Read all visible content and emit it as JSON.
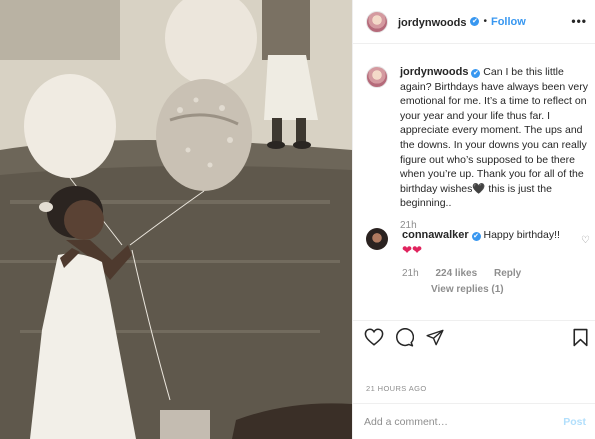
{
  "post": {
    "username": "jordynwoods",
    "verified_mark": "✔",
    "separator": "•",
    "follow_label": "Follow",
    "more_icon": "•••"
  },
  "caption": {
    "username": "jordynwoods",
    "text": "Can I be this little again? Birthdays have always been very emotional for me. It’s a time to reflect on your year and your life thus far. I appreciate every moment. The ups and the downs. In your downs you can really figure out who’s supposed to be there when you’re up. Thank you for all of the birthday wishes🖤 this is just the beginning..",
    "time": "21h"
  },
  "reply": {
    "username": "connawalker",
    "text": "Happy birthday!!",
    "hearts": "❤❤",
    "time": "21h",
    "likes": "224 likes",
    "reply_label": "Reply",
    "view_replies": "View replies (1)"
  },
  "footer": {
    "timestamp": "21 HOURS AGO",
    "comment_placeholder": "Add a comment…",
    "post_label": "Post"
  },
  "icons": {
    "like": "heart-outline-icon",
    "comment": "comment-bubble-icon",
    "share": "paper-plane-icon",
    "save": "bookmark-icon"
  },
  "colors": {
    "link_blue": "#3897f0",
    "post_disabled": "#b2dffc",
    "heart_red": "#e0245e",
    "muted_text": "#8e8e8e"
  }
}
